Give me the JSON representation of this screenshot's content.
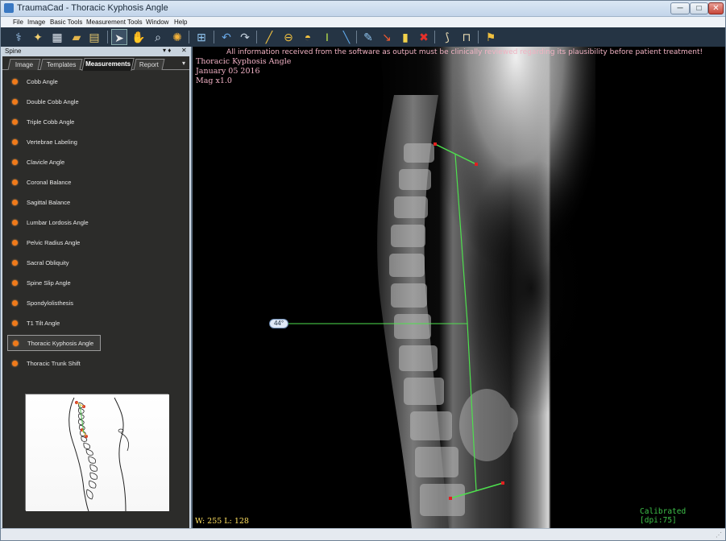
{
  "titlebar": {
    "title": "TraumaCad - Thoracic Kyphosis  Angle",
    "min": "─",
    "max": "□",
    "close": "✕"
  },
  "menu": [
    "File",
    "Image",
    "Basic Tools",
    "Measurement Tools",
    "Window",
    "Help"
  ],
  "toolbar": {
    "tools": [
      "patient-icon",
      "open-icon",
      "grid-icon",
      "folder-icon",
      "save-icon",
      "pointer-icon",
      "hand-icon",
      "zoom-icon",
      "brightness-icon",
      "layout-icon",
      "undo-icon",
      "redo-icon",
      "ruler-icon",
      "circle-icon",
      "protractor-icon",
      "i-beam-icon",
      "line-icon",
      "marker-icon",
      "arrow-icon",
      "note-icon",
      "delete-icon",
      "template-icon",
      "hardware-icon",
      "wizard-icon"
    ]
  },
  "panel": {
    "title": "Spine",
    "pin": "▾ ♦",
    "close": "✕",
    "tabs": [
      "Image",
      "Templates",
      "Measurements",
      "Report"
    ],
    "active_tab": "Measurements",
    "more": "▾",
    "measurements": [
      "Cobb Angle",
      "Double Cobb Angle",
      "Triple Cobb Angle",
      "Vertebrae Labeling",
      "Clavicle Angle",
      "Coronal Balance",
      "Sagittal Balance",
      "Lumbar Lordosis Angle",
      "Pelvic Radius Angle",
      "Sacral Obliquity",
      "Spine Slip Angle",
      "Spondylolisthesis",
      "T1 Tilt Angle",
      "Thoracic Kyphosis Angle",
      "Thoracic Trunk Shift"
    ],
    "selected": "Thoracic Kyphosis Angle"
  },
  "viewer": {
    "warning": "All information received from the software as output must be clinically reviewed regarding its plausibility before patient treatment!",
    "measurement_name": "Thoracic Kyphosis  Angle",
    "date": "January 05 2016",
    "magnification": "Mag x1.0",
    "window_level": "W: 255 L: 128",
    "calibration": "Calibrated [dpi:75]",
    "angle": "44°",
    "colors": {
      "measure_line": "#4ee04e",
      "endpoint": "#e02020",
      "overlay_text": "#f3b2c6"
    }
  }
}
